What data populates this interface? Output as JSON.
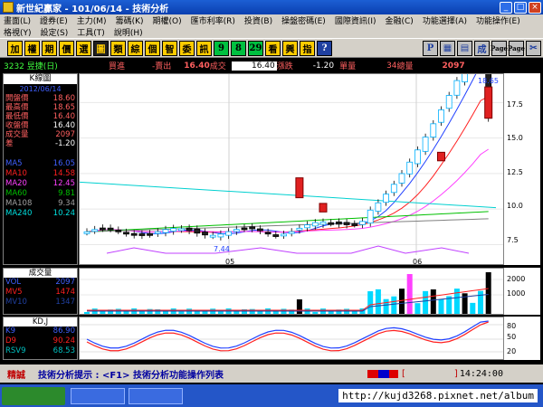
{
  "window": {
    "title": "新世紀贏家 - 101/06/14 - 技術分析"
  },
  "menu": {
    "row1": [
      "畫面(L)",
      "證券(E)",
      "主力(M)",
      "籌碼(K)",
      "期權(O)",
      "匯市利率(R)",
      "投資(B)",
      "操盤密碼(E)",
      "國際資訊(I)",
      "金融(C)",
      "功能選擇(A)",
      "功能操作(E)"
    ],
    "row2": [
      "格視(Y)",
      "設定(S)",
      "工具(T)",
      "說明(H)"
    ]
  },
  "toolbar": {
    "buttons": [
      "加",
      "權",
      "期",
      "價",
      "選",
      "圖",
      "類",
      "綜",
      "個",
      "智",
      "委",
      "訊",
      "9",
      "8",
      "29",
      "看",
      "興",
      "指",
      "?"
    ],
    "right_buttons": [
      "P",
      "▦",
      "▤",
      "成",
      "Page",
      "Page",
      "✂"
    ]
  },
  "info": {
    "code_name": "3232 昱捷(日)",
    "buy_label": "買進",
    "sell_label": "-賣出",
    "trade_price": "16.40",
    "trade_label": "成交",
    "quote_box": "16.40",
    "change_label": "漲跌",
    "change_value": "-1.20",
    "unit_label": "單量",
    "unit_value": "34",
    "total_label": "總量",
    "total_value": "2097"
  },
  "panel": {
    "header": "K線圖",
    "date": "2012/06/14",
    "stats": [
      {
        "k": "開盤價",
        "v": "18.60"
      },
      {
        "k": "最高價",
        "v": "18.65"
      },
      {
        "k": "最低價",
        "v": "16.40"
      },
      {
        "k": "收盤價",
        "v": "16.40"
      },
      {
        "k": "成交量",
        "v": "2097"
      },
      {
        "k": "差",
        "v": "-1.20"
      }
    ],
    "ma": [
      {
        "k": "MA5",
        "v": "16.05",
        "color": "#4060ff"
      },
      {
        "k": "MA10",
        "v": "14.58",
        "color": "#ff2020"
      },
      {
        "k": "MA20",
        "v": "12.45",
        "color": "#ff40ff"
      },
      {
        "k": "MA60",
        "v": "9.81",
        "color": "#00c000"
      },
      {
        "k": "MA108",
        "v": "9.34",
        "color": "#a0a0a0"
      },
      {
        "k": "MA240",
        "v": "10.24",
        "color": "#00e0e0"
      }
    ]
  },
  "chart": {
    "y_ticks": [
      "17.5",
      "15.0",
      "12.5",
      "10.0",
      "7.5"
    ],
    "x_ticks": [
      "05",
      "06"
    ],
    "high_label": "18.65",
    "low_label": "7.44"
  },
  "volume": {
    "header": "成交量",
    "rows": [
      {
        "k": "VOL",
        "v": "2097",
        "color": "#4060ff"
      },
      {
        "k": "MV5",
        "v": "1474",
        "color": "#ff2020"
      },
      {
        "k": "MV10",
        "v": "1347",
        "color": "#2040a0"
      }
    ],
    "y_ticks": [
      "2000",
      "1000"
    ]
  },
  "kd": {
    "header": "KD,J",
    "rows": [
      {
        "k": "K9",
        "v": "86.90",
        "color": "#4060ff"
      },
      {
        "k": "D9",
        "v": "90.24",
        "color": "#ff2020"
      },
      {
        "k": "RSV9",
        "v": "68.53",
        "color": "#00c0c0"
      }
    ],
    "y_ticks": [
      "80",
      "50",
      "20"
    ]
  },
  "status": {
    "tag": "精誠",
    "hint": "技術分析提示 : <F1> 技術分析功能操作列表",
    "bracket": "[",
    "bracket_close": "]",
    "time": "14:24:00"
  },
  "taskbar": {
    "url": "http://kujd3268.pixnet.net/album"
  }
}
